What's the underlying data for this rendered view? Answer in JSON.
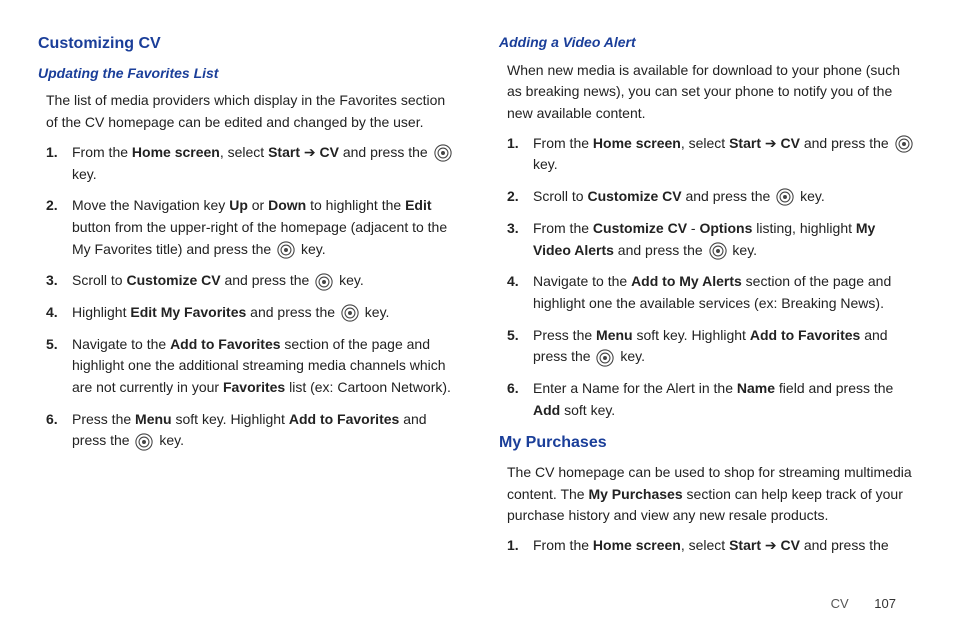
{
  "left": {
    "heading": "Customizing CV",
    "sub": "Updating the Favorites List",
    "intro": "The list of media providers which display in the Favorites section of the CV homepage can be edited and changed by the user.",
    "steps": [
      {
        "n": "1.",
        "pre": "From the ",
        "b1": "Home screen",
        "mid1": ", select ",
        "b2": "Start",
        "arrow": " ➔ ",
        "b3": "CV",
        "mid2": " and press the ",
        "tail": " key."
      },
      {
        "n": "2.",
        "pre": "Move the Navigation key ",
        "b1": "Up",
        "mid1": " or ",
        "b2": "Down",
        "mid2": " to highlight the ",
        "b3": "Edit",
        "mid3": " button from the upper-right of the homepage (adjacent to the My Favorites title) and press the ",
        "tail": " key."
      },
      {
        "n": "3.",
        "pre": "Scroll to ",
        "b1": "Customize CV",
        "mid1": " and press the ",
        "tail": " key."
      },
      {
        "n": "4.",
        "pre": "Highlight ",
        "b1": "Edit My Favorites",
        "mid1": " and press the ",
        "tail": " key."
      },
      {
        "n": "5.",
        "pre": "Navigate to the ",
        "b1": "Add to Favorites",
        "mid1": " section of the page and highlight one the additional streaming media channels which are not currently in your ",
        "b2": "Favorites",
        "mid2": " list (ex: Cartoon Network)."
      },
      {
        "n": "6.",
        "pre": "Press the ",
        "b1": "Menu",
        "mid1": " soft key. Highlight ",
        "b2": "Add to Favorites",
        "mid2": " and press the ",
        "tail": " key."
      }
    ]
  },
  "right": {
    "sub": "Adding a Video Alert",
    "intro": "When new media is available for download to your phone (such as breaking news), you can set your phone to notify you of the new available content.",
    "steps": [
      {
        "n": "1.",
        "pre": "From the ",
        "b1": "Home screen",
        "mid1": ", select ",
        "b2": "Start",
        "arrow": " ➔ ",
        "b3": "CV",
        "mid2": " and press the ",
        "tail": " key."
      },
      {
        "n": "2.",
        "pre": "Scroll to ",
        "b1": "Customize CV",
        "mid1": " and press the ",
        "tail": " key."
      },
      {
        "n": "3.",
        "pre": "From the ",
        "b1": "Customize CV",
        "mid1": " - ",
        "b2": "Options",
        "mid2": " listing, highlight ",
        "b3": "My Video Alerts",
        "mid3": " and press the ",
        "tail": " key."
      },
      {
        "n": "4.",
        "pre": "Navigate to the ",
        "b1": "Add to My Alerts",
        "mid1": " section of the page and highlight one the available services (ex: Breaking News)."
      },
      {
        "n": "5.",
        "pre": "Press the ",
        "b1": "Menu",
        "mid1": " soft key. Highlight ",
        "b2": "Add to Favorites",
        "mid2": " and press the ",
        "tail": " key."
      },
      {
        "n": "6.",
        "pre": "Enter a Name for the Alert in the ",
        "b1": "Name",
        "mid1": " field and press the ",
        "b2": "Add",
        "mid2": " soft key."
      }
    ],
    "heading2": "My Purchases",
    "intro2a": "The CV homepage can be used to shop for streaming multimedia content. The ",
    "intro2b": "My Purchases",
    "intro2c": " section can help keep track of your purchase history and view any new resale products.",
    "steps2": [
      {
        "n": "1.",
        "pre": "From the ",
        "b1": "Home screen",
        "mid1": ", select ",
        "b2": "Start",
        "arrow": " ➔ ",
        "b3": "CV",
        "mid2": " and press the"
      }
    ]
  },
  "footer": {
    "section": "CV",
    "page": "107"
  },
  "icon_name": "ok-key-icon"
}
